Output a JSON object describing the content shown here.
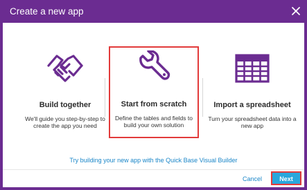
{
  "dialog": {
    "title": "Create a new app",
    "close_icon": "close-icon",
    "accent_color": "#6b2c91"
  },
  "options": [
    {
      "icon": "handshake-icon",
      "title": "Build together",
      "description": "We'll guide you step-by-step to create the app you need"
    },
    {
      "icon": "wrench-icon",
      "title": "Start from scratch",
      "description": "Define the tables and fields to build your own solution",
      "selected": true
    },
    {
      "icon": "spreadsheet-icon",
      "title": "Import a spreadsheet",
      "description": "Turn your spreadsheet data into a new app"
    }
  ],
  "builder_link": "Try building your new app with the Quick Base Visual Builder",
  "footer": {
    "cancel_label": "Cancel",
    "next_label": "Next"
  }
}
